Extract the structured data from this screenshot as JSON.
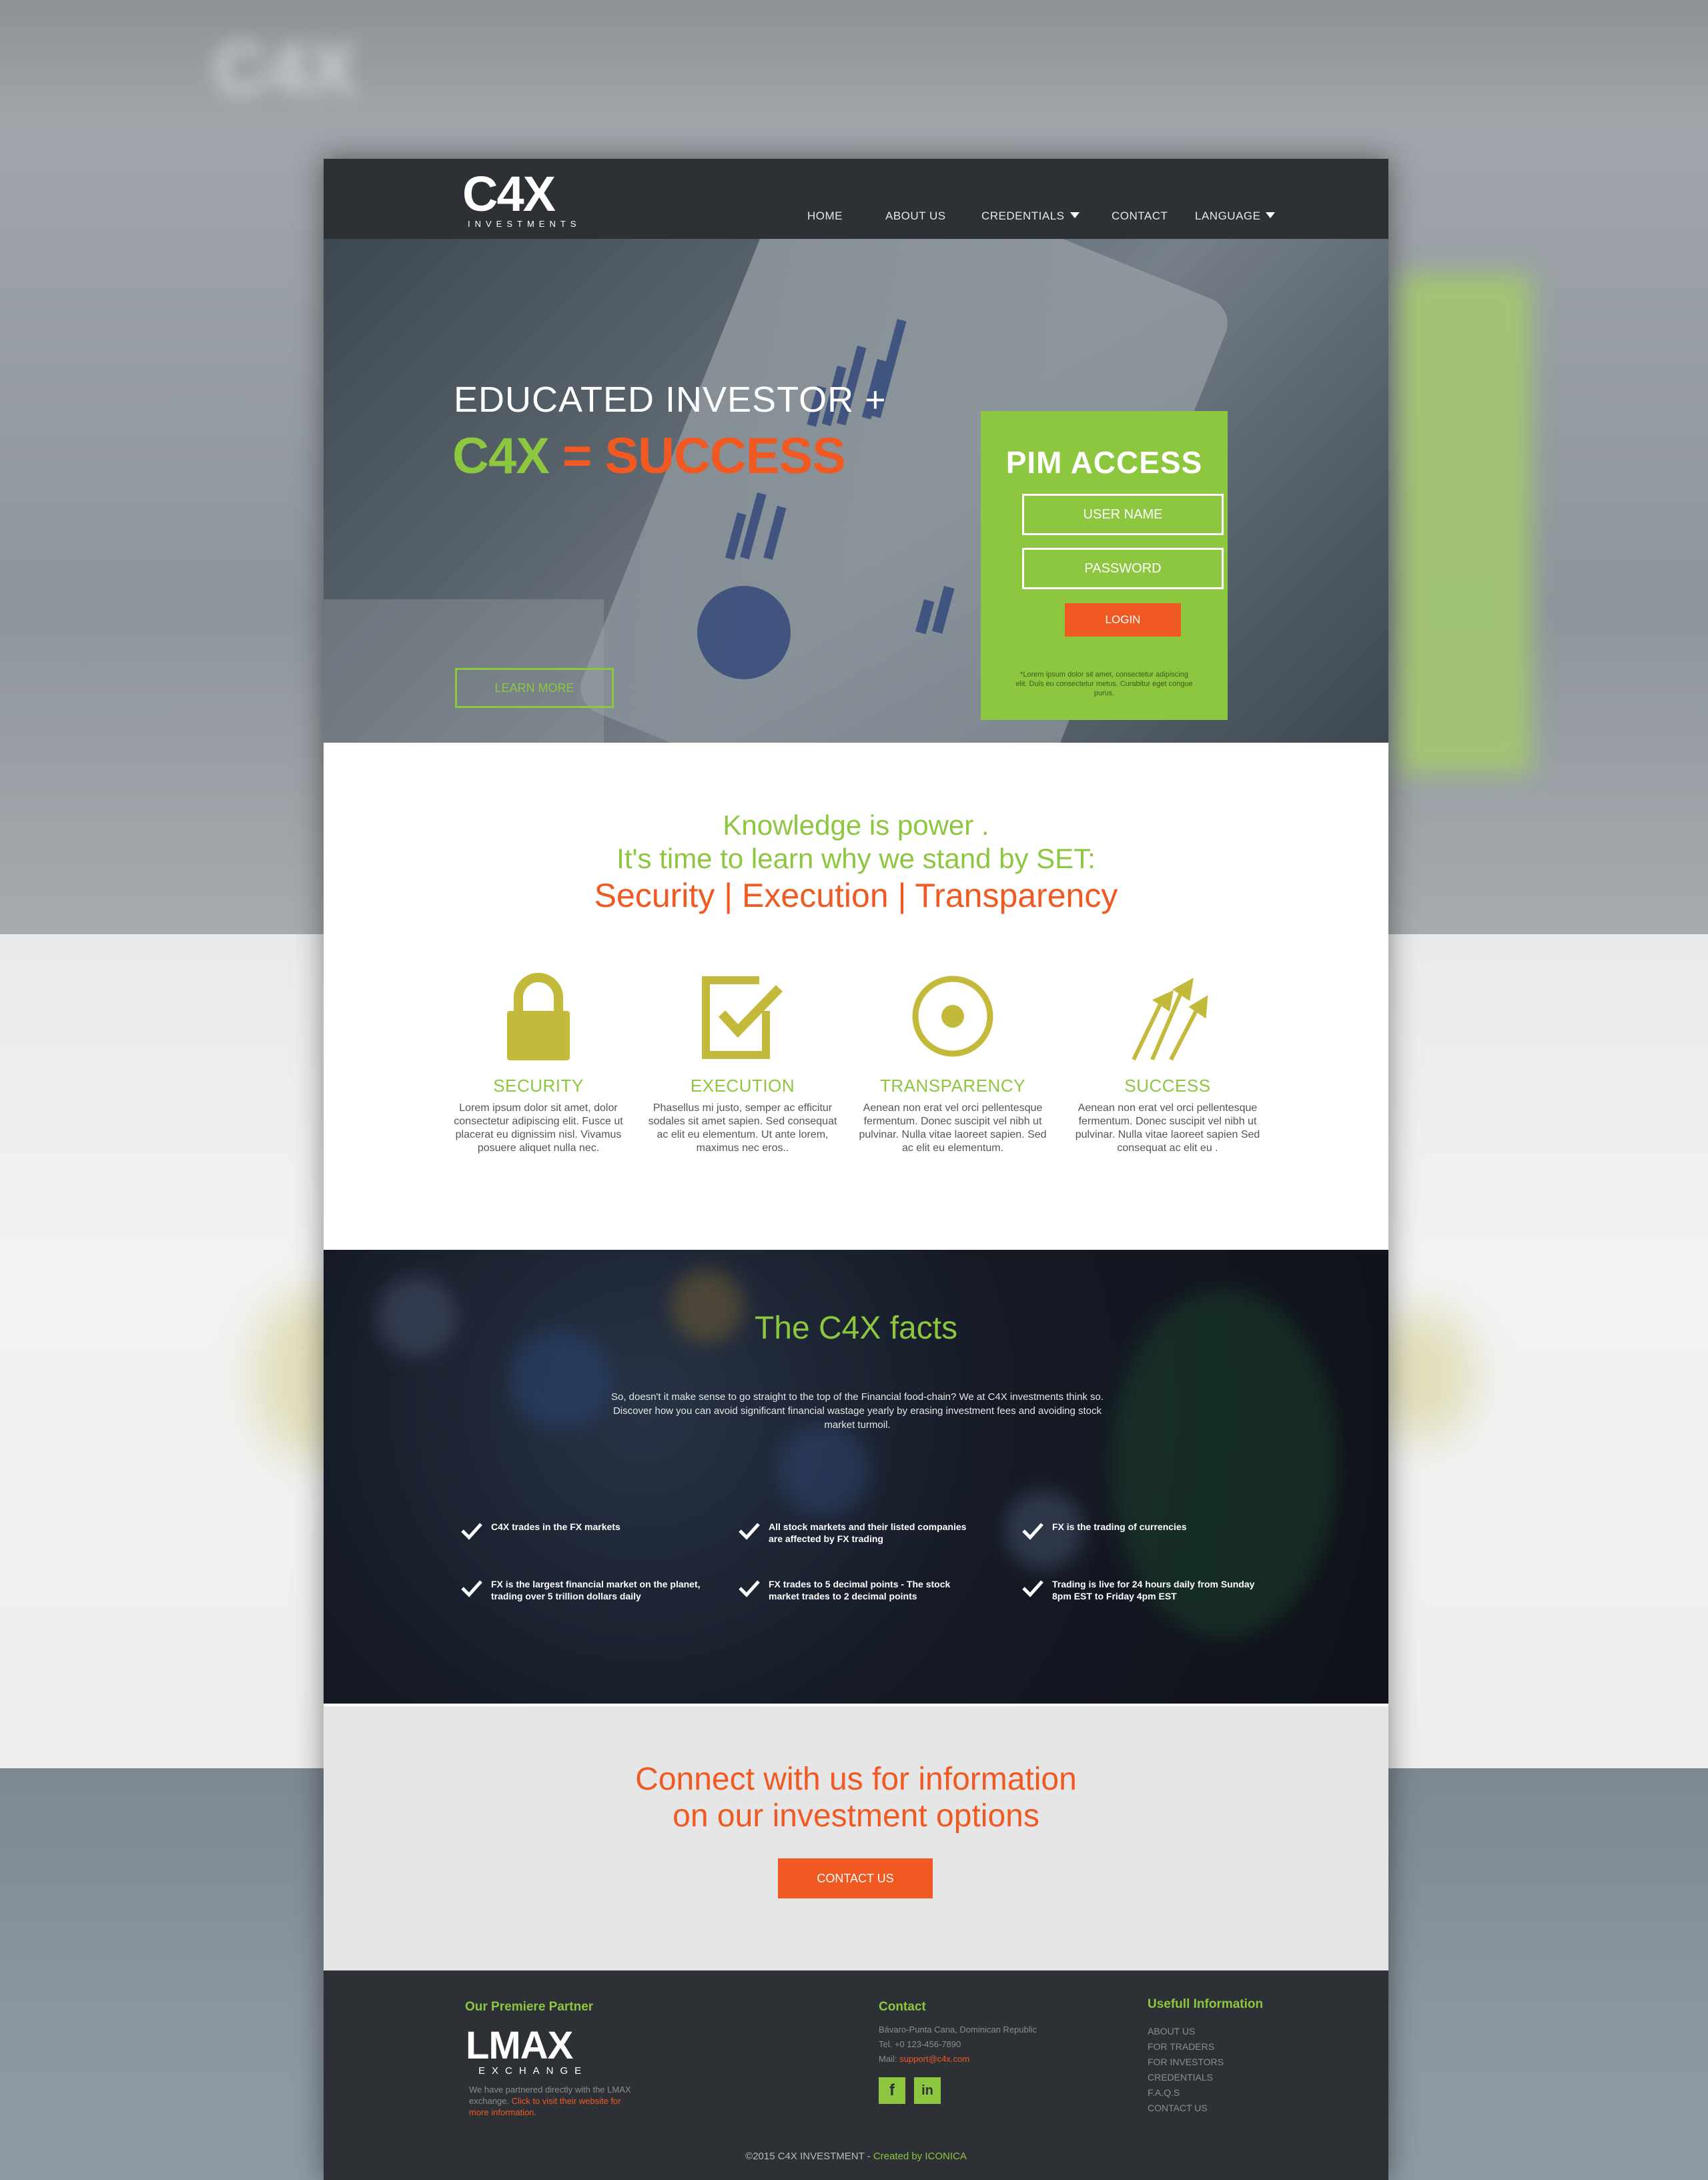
{
  "brand": {
    "logo": "C4X",
    "logo_sub": "INVESTMENTS"
  },
  "nav": {
    "home": "HOME",
    "about": "ABOUT US",
    "credentials": "CREDENTIALS",
    "contact": "CONTACT",
    "language": "LANGUAGE"
  },
  "hero": {
    "line1": "EDUCATED INVESTOR +",
    "c4x": "C4X",
    "eq": " = ",
    "success": "SUCCESS",
    "learn_more": "LEARN MORE"
  },
  "pim": {
    "title": "PIM ACCESS",
    "username_placeholder": "USER NAME",
    "password_placeholder": "PASSWORD",
    "login": "LOGIN",
    "note": "*Lorem ipsum dolor sit amet, consectetur adipiscing elit. Duis eu consectetur metus. Curabitur eget congue purus."
  },
  "set": {
    "line1": "Knowledge is power .",
    "line2": "It's time to learn why we stand by SET:",
    "line3": "Security | Execution | Transparency",
    "features": [
      {
        "title": "SECURITY",
        "desc": "Lorem ipsum dolor sit amet, dolor consectetur adipiscing elit. Fusce ut placerat eu dignissim nisl. Vivamus posuere aliquet nulla nec.",
        "icon": "lock-icon"
      },
      {
        "title": "EXECUTION",
        "desc": "Phasellus mi justo, semper ac efficitur sodales sit amet sapien. Sed consequat ac elit eu elementum. Ut ante lorem, maximus nec eros..",
        "icon": "checkbox-icon"
      },
      {
        "title": "TRANSPARENCY",
        "desc": "Aenean non erat vel orci pellentesque fermentum. Donec suscipit vel nibh ut pulvinar. Nulla vitae laoreet sapien. Sed ac elit eu elementum.",
        "icon": "target-icon"
      },
      {
        "title": "SUCCESS",
        "desc": "Aenean non erat vel orci pellentesque fermentum. Donec suscipit vel nibh ut pulvinar. Nulla vitae laoreet sapien Sed consequat ac elit eu .",
        "icon": "arrows-up-icon"
      }
    ]
  },
  "facts": {
    "title": "The C4X facts",
    "desc": "So, doesn't it make sense to go straight to the top of the Financial food-chain? We at C4X investments think so. Discover how you can avoid significant financial wastage yearly by erasing investment fees and avoiding stock market turmoil.",
    "items": [
      "C4X trades in the FX markets",
      "All stock markets and their listed companies are affected by FX trading",
      "FX is the trading of currencies",
      "FX is the largest financial market on the planet, trading over 5 trillion dollars daily",
      "FX trades to 5 decimal points - The stock market trades to 2 decimal points",
      "Trading is live for 24 hours daily from Sunday 8pm EST to Friday 4pm EST"
    ]
  },
  "connect": {
    "line1": "Connect with us for information",
    "line2": "on our investment options",
    "button": "CONTACT US"
  },
  "footer": {
    "partner_heading": "Our Premiere Partner",
    "partner_logo": "LMAX",
    "partner_logo_sub": "EXCHANGE",
    "partner_text": "We have partnered directly with the LMAX exchange.",
    "partner_link": "Click to visit their website for more information.",
    "contact_heading": "Contact",
    "address": "Bávaro-Punta Cana, Dominican Republic",
    "tel": "Tel. +0 123-456-7890",
    "mail_label": "Mail:",
    "mail": "support@c4x.com",
    "facebook": "f",
    "linkedin": "in",
    "info_heading": "Usefull Information",
    "links": [
      "ABOUT US",
      "FOR TRADERS",
      "FOR INVESTORS",
      "CREDENTIALS",
      "F.A.Q.S",
      "CONTACT US"
    ],
    "copyright": "©2015 C4X INVESTMENT - ",
    "created_by": "Created by ICONICA"
  },
  "colors": {
    "green": "#8dc63f",
    "orange": "#f05a22",
    "dark": "#2d3034",
    "icon_olive": "#c3b93a"
  }
}
